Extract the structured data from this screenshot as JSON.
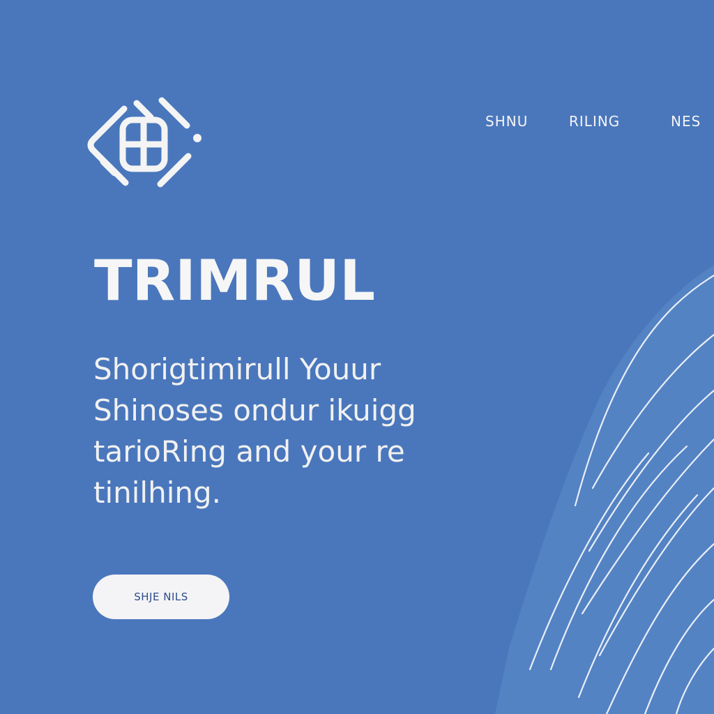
{
  "logo": {
    "icon": "brand-logo-icon",
    "color": "#f4f4f4"
  },
  "nav": {
    "items": [
      {
        "label": "SHNU"
      },
      {
        "label": "RILING"
      },
      {
        "label": "NES"
      }
    ]
  },
  "hero": {
    "title": "TRIMRUL",
    "body": "Shorigtimirull Youur Shinoses ondur ikuigg tarioRing and your re tinilhing.",
    "cta_label": "SHJE NILS"
  },
  "decoration": {
    "icon": "wave-lines-graphic"
  },
  "colors": {
    "background": "#4a77bc",
    "text": "#f4f4f4",
    "button_bg": "#f4f4f6",
    "button_text": "#2c4c8c",
    "wave_fill": "#5d8ecb"
  }
}
